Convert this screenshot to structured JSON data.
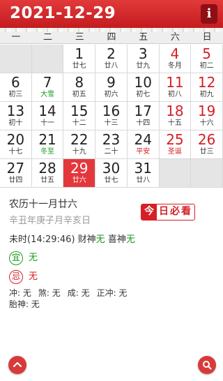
{
  "header": {
    "title": "2021-12-29",
    "info_label": "i"
  },
  "weekdays": [
    "一",
    "二",
    "三",
    "四",
    "五",
    "六",
    "日"
  ],
  "weeks": [
    [
      {
        "day": "",
        "lunar": ""
      },
      {
        "day": "",
        "lunar": ""
      },
      {
        "day": "1",
        "lunar": "廿七"
      },
      {
        "day": "2",
        "lunar": "廿八"
      },
      {
        "day": "3",
        "lunar": "廿九"
      },
      {
        "day": "4",
        "lunar": "冬月"
      },
      {
        "day": "5",
        "lunar": "初二"
      }
    ],
    [
      {
        "day": "6",
        "lunar": "初三"
      },
      {
        "day": "7",
        "lunar": "大雪",
        "style": "green"
      },
      {
        "day": "8",
        "lunar": "初五"
      },
      {
        "day": "9",
        "lunar": "初六"
      },
      {
        "day": "10",
        "lunar": "初七"
      },
      {
        "day": "11",
        "lunar": "初八"
      },
      {
        "day": "12",
        "lunar": "初九"
      }
    ],
    [
      {
        "day": "13",
        "lunar": "初十"
      },
      {
        "day": "14",
        "lunar": "十一"
      },
      {
        "day": "15",
        "lunar": "十二"
      },
      {
        "day": "16",
        "lunar": "十三"
      },
      {
        "day": "17",
        "lunar": "十四"
      },
      {
        "day": "18",
        "lunar": "十五"
      },
      {
        "day": "19",
        "lunar": "十六"
      }
    ],
    [
      {
        "day": "20",
        "lunar": "十七"
      },
      {
        "day": "21",
        "lunar": "冬至",
        "style": "green"
      },
      {
        "day": "22",
        "lunar": "十九"
      },
      {
        "day": "23",
        "lunar": "二十"
      },
      {
        "day": "24",
        "lunar": "平安",
        "style": "red"
      },
      {
        "day": "25",
        "lunar": "圣诞",
        "style": "red"
      },
      {
        "day": "26",
        "lunar": "廿三"
      }
    ],
    [
      {
        "day": "27",
        "lunar": "廿四"
      },
      {
        "day": "28",
        "lunar": "廿五"
      },
      {
        "day": "29",
        "lunar": "廿六",
        "today": true
      },
      {
        "day": "30",
        "lunar": "廿七"
      },
      {
        "day": "31",
        "lunar": "廿八"
      },
      {
        "day": "",
        "lunar": ""
      },
      {
        "day": "",
        "lunar": ""
      }
    ]
  ],
  "detail": {
    "lunar_date": "农历十一月廿六",
    "ganzhi": "辛丑年庚子月辛亥日",
    "must_see_first": "今",
    "must_see_rest": "日必看",
    "time_prefix": "未时(14:29:46) 财神",
    "caishen": "无",
    "xishen_label": " 喜神",
    "xishen": "无",
    "yi_label": "宜",
    "yi_value": "无",
    "ji_label": "忌",
    "ji_value": "无",
    "chong": "冲: 无",
    "sha": "煞: 无",
    "cheng": "成: 无",
    "zhengchong": "正冲: 无",
    "taishen": "胎神: 无"
  },
  "icons": {
    "left_fab": "chevron-up-icon",
    "right_fab": "search-icon"
  },
  "colors": {
    "accent": "#d42026",
    "green": "#1c9a1c",
    "header": "#c31b1f"
  }
}
